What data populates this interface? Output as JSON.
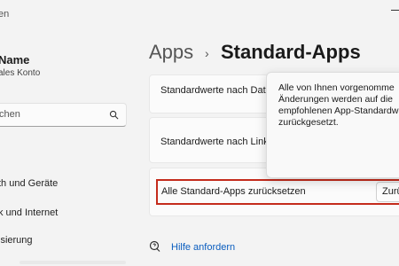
{
  "window": {
    "title": "en"
  },
  "user": {
    "name": "Name",
    "account": "ales Konto"
  },
  "search": {
    "placeholder": "chen"
  },
  "nav": {
    "items": [
      {
        "label": "th und Geräte"
      },
      {
        "label": "k und Internet"
      },
      {
        "label": "isierung"
      }
    ]
  },
  "breadcrumb": {
    "parent": "Apps",
    "separator": "›",
    "current": "Standard-Apps"
  },
  "cards": {
    "defaults_by_type": "Standardwerte nach Date",
    "defaults_by_link": "Standardwerte nach Linkt",
    "reset_all": "Alle Standard-Apps zurücksetzen",
    "reset_button": "Zurü"
  },
  "popup": {
    "lines": [
      "Alle von Ihnen vorgenomme",
      "Änderungen werden auf die",
      "empfohlenen App-Standardw",
      "zurückgesetzt."
    ]
  },
  "help": {
    "label": "Hilfe anfordern"
  },
  "colors": {
    "accent": "#c42b1c",
    "link": "#0a5dbf"
  }
}
